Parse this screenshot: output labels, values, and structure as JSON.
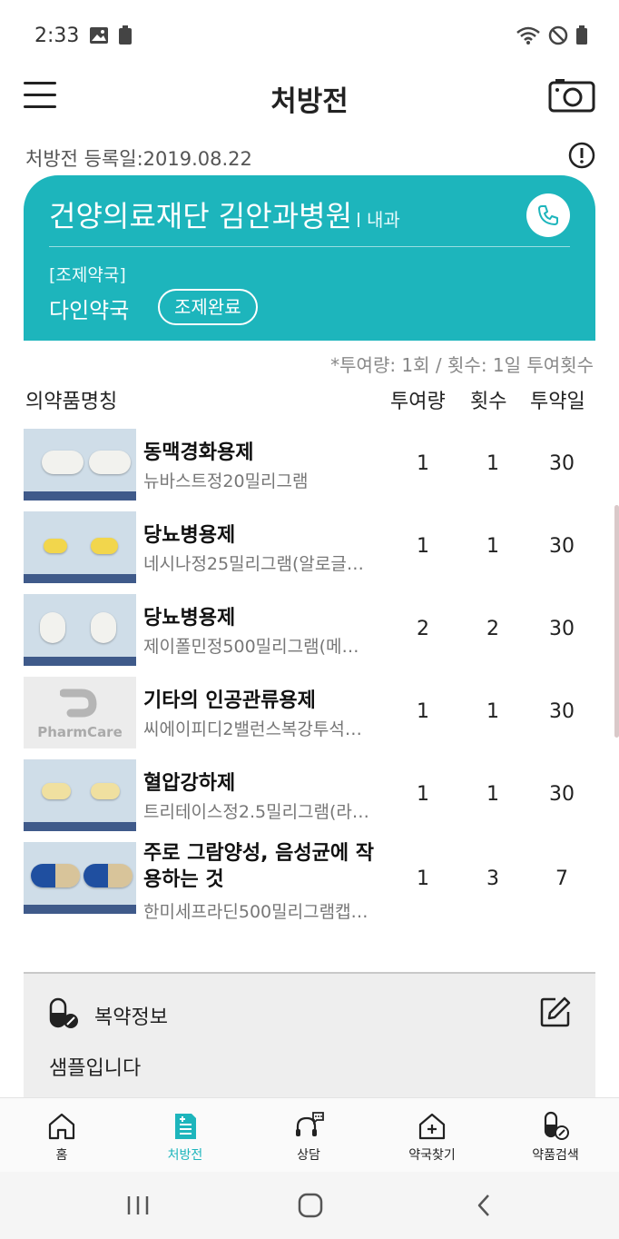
{
  "status_bar": {
    "time": "2:33",
    "battery_label": "100"
  },
  "app_bar": {
    "title": "처방전"
  },
  "registration": {
    "label": "처방전 등록일:",
    "date": "2019.08.22",
    "full": "처방전 등록일:2019.08.22"
  },
  "hospital_card": {
    "hospital_name": "건양의료재단 김안과병원",
    "department": "내과",
    "pharmacy_label": "[조제약국]",
    "pharmacy_name": "다인약국",
    "dispense_status": "조제완료",
    "accent_color": "#1db5bc"
  },
  "dose_note": "*투여량: 1회 / 횟수: 1일 투여횟수",
  "table_header": {
    "name": "의약품명칭",
    "dose": "투여량",
    "freq": "횟수",
    "days": "투약일"
  },
  "drugs": [
    {
      "category": "동맥경화용제",
      "name": "뉴바스트정20밀리그램",
      "dose": "1",
      "freq": "1",
      "days": "30",
      "thumb": "pill-photo"
    },
    {
      "category": "당뇨병용제",
      "name": "네시나정25밀리그램(알로글…",
      "dose": "1",
      "freq": "1",
      "days": "30",
      "thumb": "pill-photo"
    },
    {
      "category": "당뇨병용제",
      "name": "제이폴민정500밀리그램(메…",
      "dose": "2",
      "freq": "2",
      "days": "30",
      "thumb": "pill-photo"
    },
    {
      "category": "기타의 인공관류용제",
      "name": "씨에이피디2밸런스복강투석…",
      "dose": "1",
      "freq": "1",
      "days": "30",
      "thumb": "pharmcare-placeholder",
      "thumb_text": "PharmCare"
    },
    {
      "category": "혈압강하제",
      "name": "트리테이스정2.5밀리그램(라…",
      "dose": "1",
      "freq": "1",
      "days": "30",
      "thumb": "pill-photo"
    },
    {
      "category": "주로 그람양성, 음성균에 작용하는 것",
      "name": "한미세프라딘500밀리그램캡…",
      "dose": "1",
      "freq": "3",
      "days": "7",
      "thumb": "capsule-photo"
    }
  ],
  "med_info": {
    "title": "복약정보",
    "text": "샘플입니다"
  },
  "bottom_nav": [
    {
      "label": "홈",
      "icon": "home-icon"
    },
    {
      "label": "처방전",
      "icon": "prescription-icon",
      "active": true
    },
    {
      "label": "상담",
      "icon": "consult-icon"
    },
    {
      "label": "약국찾기",
      "icon": "pharmacy-find-icon"
    },
    {
      "label": "약품검색",
      "icon": "drug-search-icon"
    }
  ]
}
